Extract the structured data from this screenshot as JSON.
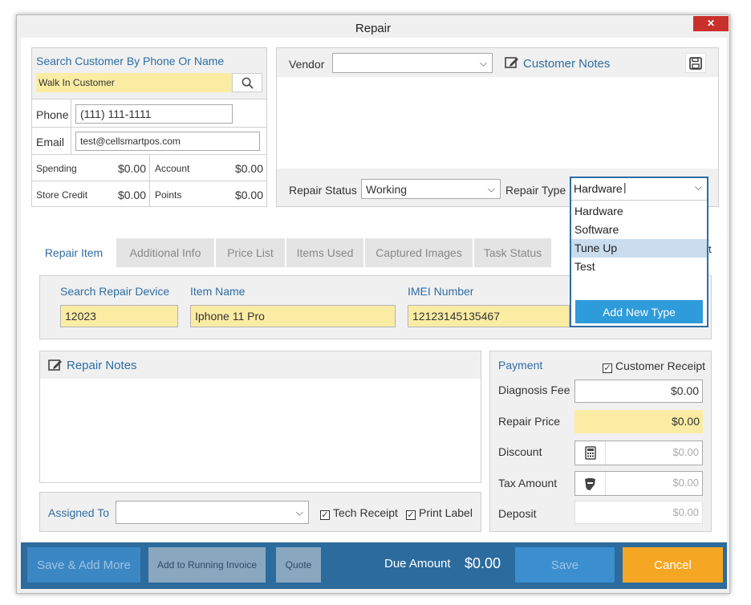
{
  "window": {
    "title": "Repair",
    "close_label": "✕"
  },
  "customer": {
    "search_label": "Search Customer By Phone Or Name",
    "search_value": "Walk In Customer",
    "phone_label": "Phone",
    "phone_value": "(111) 111-1111",
    "email_label": "Email",
    "email_value": "test@cellsmartpos.com",
    "spending_label": "Spending",
    "spending_value": "$0.00",
    "account_label": "Account",
    "account_value": "$0.00",
    "store_credit_label": "Store Credit",
    "store_credit_value": "$0.00",
    "points_label": "Points",
    "points_value": "$0.00"
  },
  "vendor_panel": {
    "vendor_label": "Vendor",
    "vendor_value": "",
    "customer_notes_label": "Customer Notes",
    "repair_status_label": "Repair Status",
    "repair_status_value": "Working",
    "repair_type_label": "Repair Type",
    "repair_type_value": "Hardware"
  },
  "dropdown": {
    "options": [
      "Hardware",
      "Software",
      "Tune Up",
      "Test"
    ],
    "highlighted": "Tune Up",
    "add_new_label": "Add New Type"
  },
  "tabs": [
    "Repair Item",
    "Additional Info",
    "Price List",
    "Items Used",
    "Captured Images",
    "Task Status"
  ],
  "tab_overflow_text": "t",
  "repair_item": {
    "device_label": "Search Repair Device",
    "device_value": "12023",
    "item_name_label": "Item Name",
    "item_name_value": "Iphone 11 Pro",
    "imei_label": "IMEI Number",
    "imei_value": "12123145135467"
  },
  "repair_notes": {
    "label": "Repair Notes"
  },
  "assign": {
    "assigned_to_label": "Assigned To",
    "assigned_to_value": "",
    "tech_receipt_label": "Tech Receipt",
    "print_label_label": "Print Label"
  },
  "payment": {
    "title": "Payment",
    "customer_receipt_label": "Customer Receipt",
    "diagnosis_fee_label": "Diagnosis Fee",
    "diagnosis_fee_value": "$0.00",
    "repair_price_label": "Repair Price",
    "repair_price_value": "$0.00",
    "discount_label": "Discount",
    "discount_value": "$0.00",
    "tax_label": "Tax Amount",
    "tax_value": "$0.00",
    "deposit_label": "Deposit",
    "deposit_value": "$0.00"
  },
  "footer": {
    "save_add_more": "Save & Add More",
    "add_running_invoice": "Add to Running Invoice",
    "quote": "Quote",
    "due_amount_label": "Due Amount",
    "due_amount_value": "$0.00",
    "save": "Save",
    "cancel": "Cancel"
  },
  "colors": {
    "accent_blue": "#2e6da4",
    "highlight_yellow": "#fbeca4",
    "footer_blue": "#2b6b9e",
    "cancel_orange": "#f5a623"
  }
}
